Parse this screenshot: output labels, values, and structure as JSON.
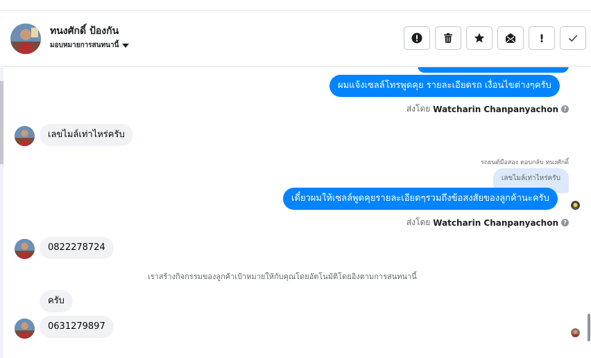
{
  "header": {
    "contact_name": "ทนงศักดิ์ ป้องกัน",
    "assign_label": "มอบหมายการสนทนานี้"
  },
  "toolbar": {
    "buttons": [
      {
        "name": "spam",
        "icon": "exclamation-circle-icon"
      },
      {
        "name": "delete",
        "icon": "trash-icon"
      },
      {
        "name": "star",
        "icon": "star-icon"
      },
      {
        "name": "mark-unread",
        "icon": "envelope-icon"
      },
      {
        "name": "follow-up",
        "icon": "exclamation-icon",
        "glyph": "!"
      },
      {
        "name": "done",
        "icon": "check-icon"
      }
    ]
  },
  "messages": {
    "out_1": "ผมแจ้งเซลล์โทรพูดคุย รายละเอียดรถ เงื่อนไขต่างๆครับ",
    "sent_by_label": "ส่งโดย",
    "agent_name": "Watcharin Chanpanyachon",
    "info_glyph": "?",
    "in_1": "เลขไมล์เท่าไหร่ครับ",
    "reply_note": "รถยนต์มือสอง ตอบกลับ ทนงศักดิ์",
    "quoted_text": "เลขไมล์เท่าไหร่ครับ",
    "out_2": "เดี๋ยวผมให้เซลล์พูดคุยรายละเอียดๆรวมถึงข้อสงสัยของลูกค้านะครับ",
    "in_2": "0822278724",
    "system_note": "เราสร้างกิจกรรมของลูกค้าเป้าหมายให้กับคุณโดยอัตโนมัติโดยอิงตามการสนทนานี้",
    "in_3": "ครับ",
    "in_4": "0631279897"
  },
  "colors": {
    "outgoing_bubble": "#0084ff",
    "incoming_bubble": "#f0f2f5",
    "quote_bubble": "#dbe9fb"
  }
}
